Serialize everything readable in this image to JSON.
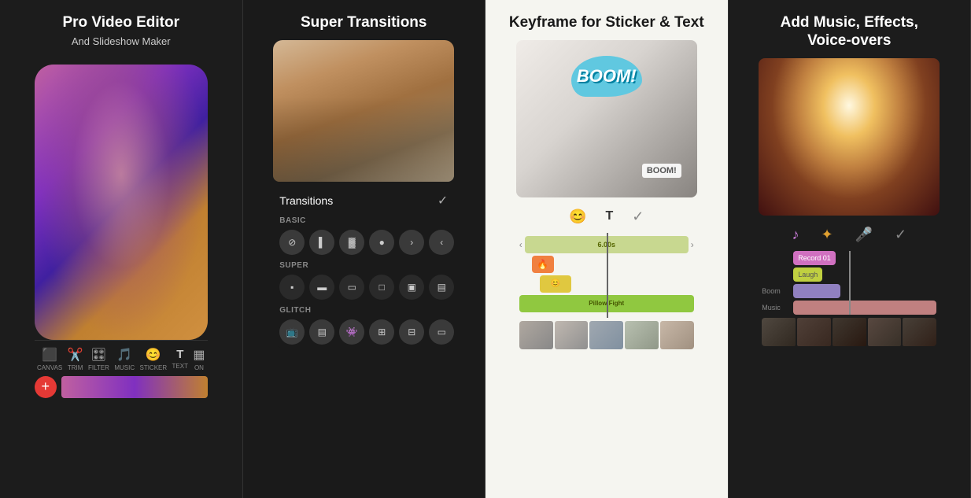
{
  "panels": [
    {
      "id": "panel1",
      "title": "Pro Video Editor",
      "subtitle": "And Slideshow Maker",
      "toolbar_items": [
        {
          "icon": "⬛",
          "label": "CANVAS"
        },
        {
          "icon": "✂️",
          "label": "TRIM"
        },
        {
          "icon": "🎛",
          "label": "FILTER"
        },
        {
          "icon": "🎵",
          "label": "MUSIC"
        },
        {
          "icon": "😊",
          "label": "STICKER"
        },
        {
          "icon": "T",
          "label": "TEXT"
        },
        {
          "icon": "▦",
          "label": "ON"
        }
      ]
    },
    {
      "id": "panel2",
      "title": "Super Transitions",
      "sections": [
        {
          "label": "BASIC",
          "count": 6
        },
        {
          "label": "SUPER",
          "count": 6
        },
        {
          "label": "GLITCH",
          "count": 6
        }
      ]
    },
    {
      "id": "panel3",
      "title_normal": "Keyframe",
      "title_rest": " for Sticker & Text",
      "clip_label": "Pillow Fight"
    },
    {
      "id": "panel4",
      "title": "Add Music, Effects, Voice-overs",
      "tracks": [
        {
          "label": "Record 01",
          "type": "record"
        },
        {
          "label": "Laugh",
          "type": "length"
        },
        {
          "label": "Boom",
          "type": "boom"
        },
        {
          "label": "Music",
          "type": "music"
        }
      ]
    }
  ],
  "colors": {
    "accent_red": "#e53935",
    "accent_green": "#c8d890",
    "accent_purple": "#9080c0",
    "panel_dark": "#1c1c1c",
    "panel_light": "#f5f5f0"
  }
}
